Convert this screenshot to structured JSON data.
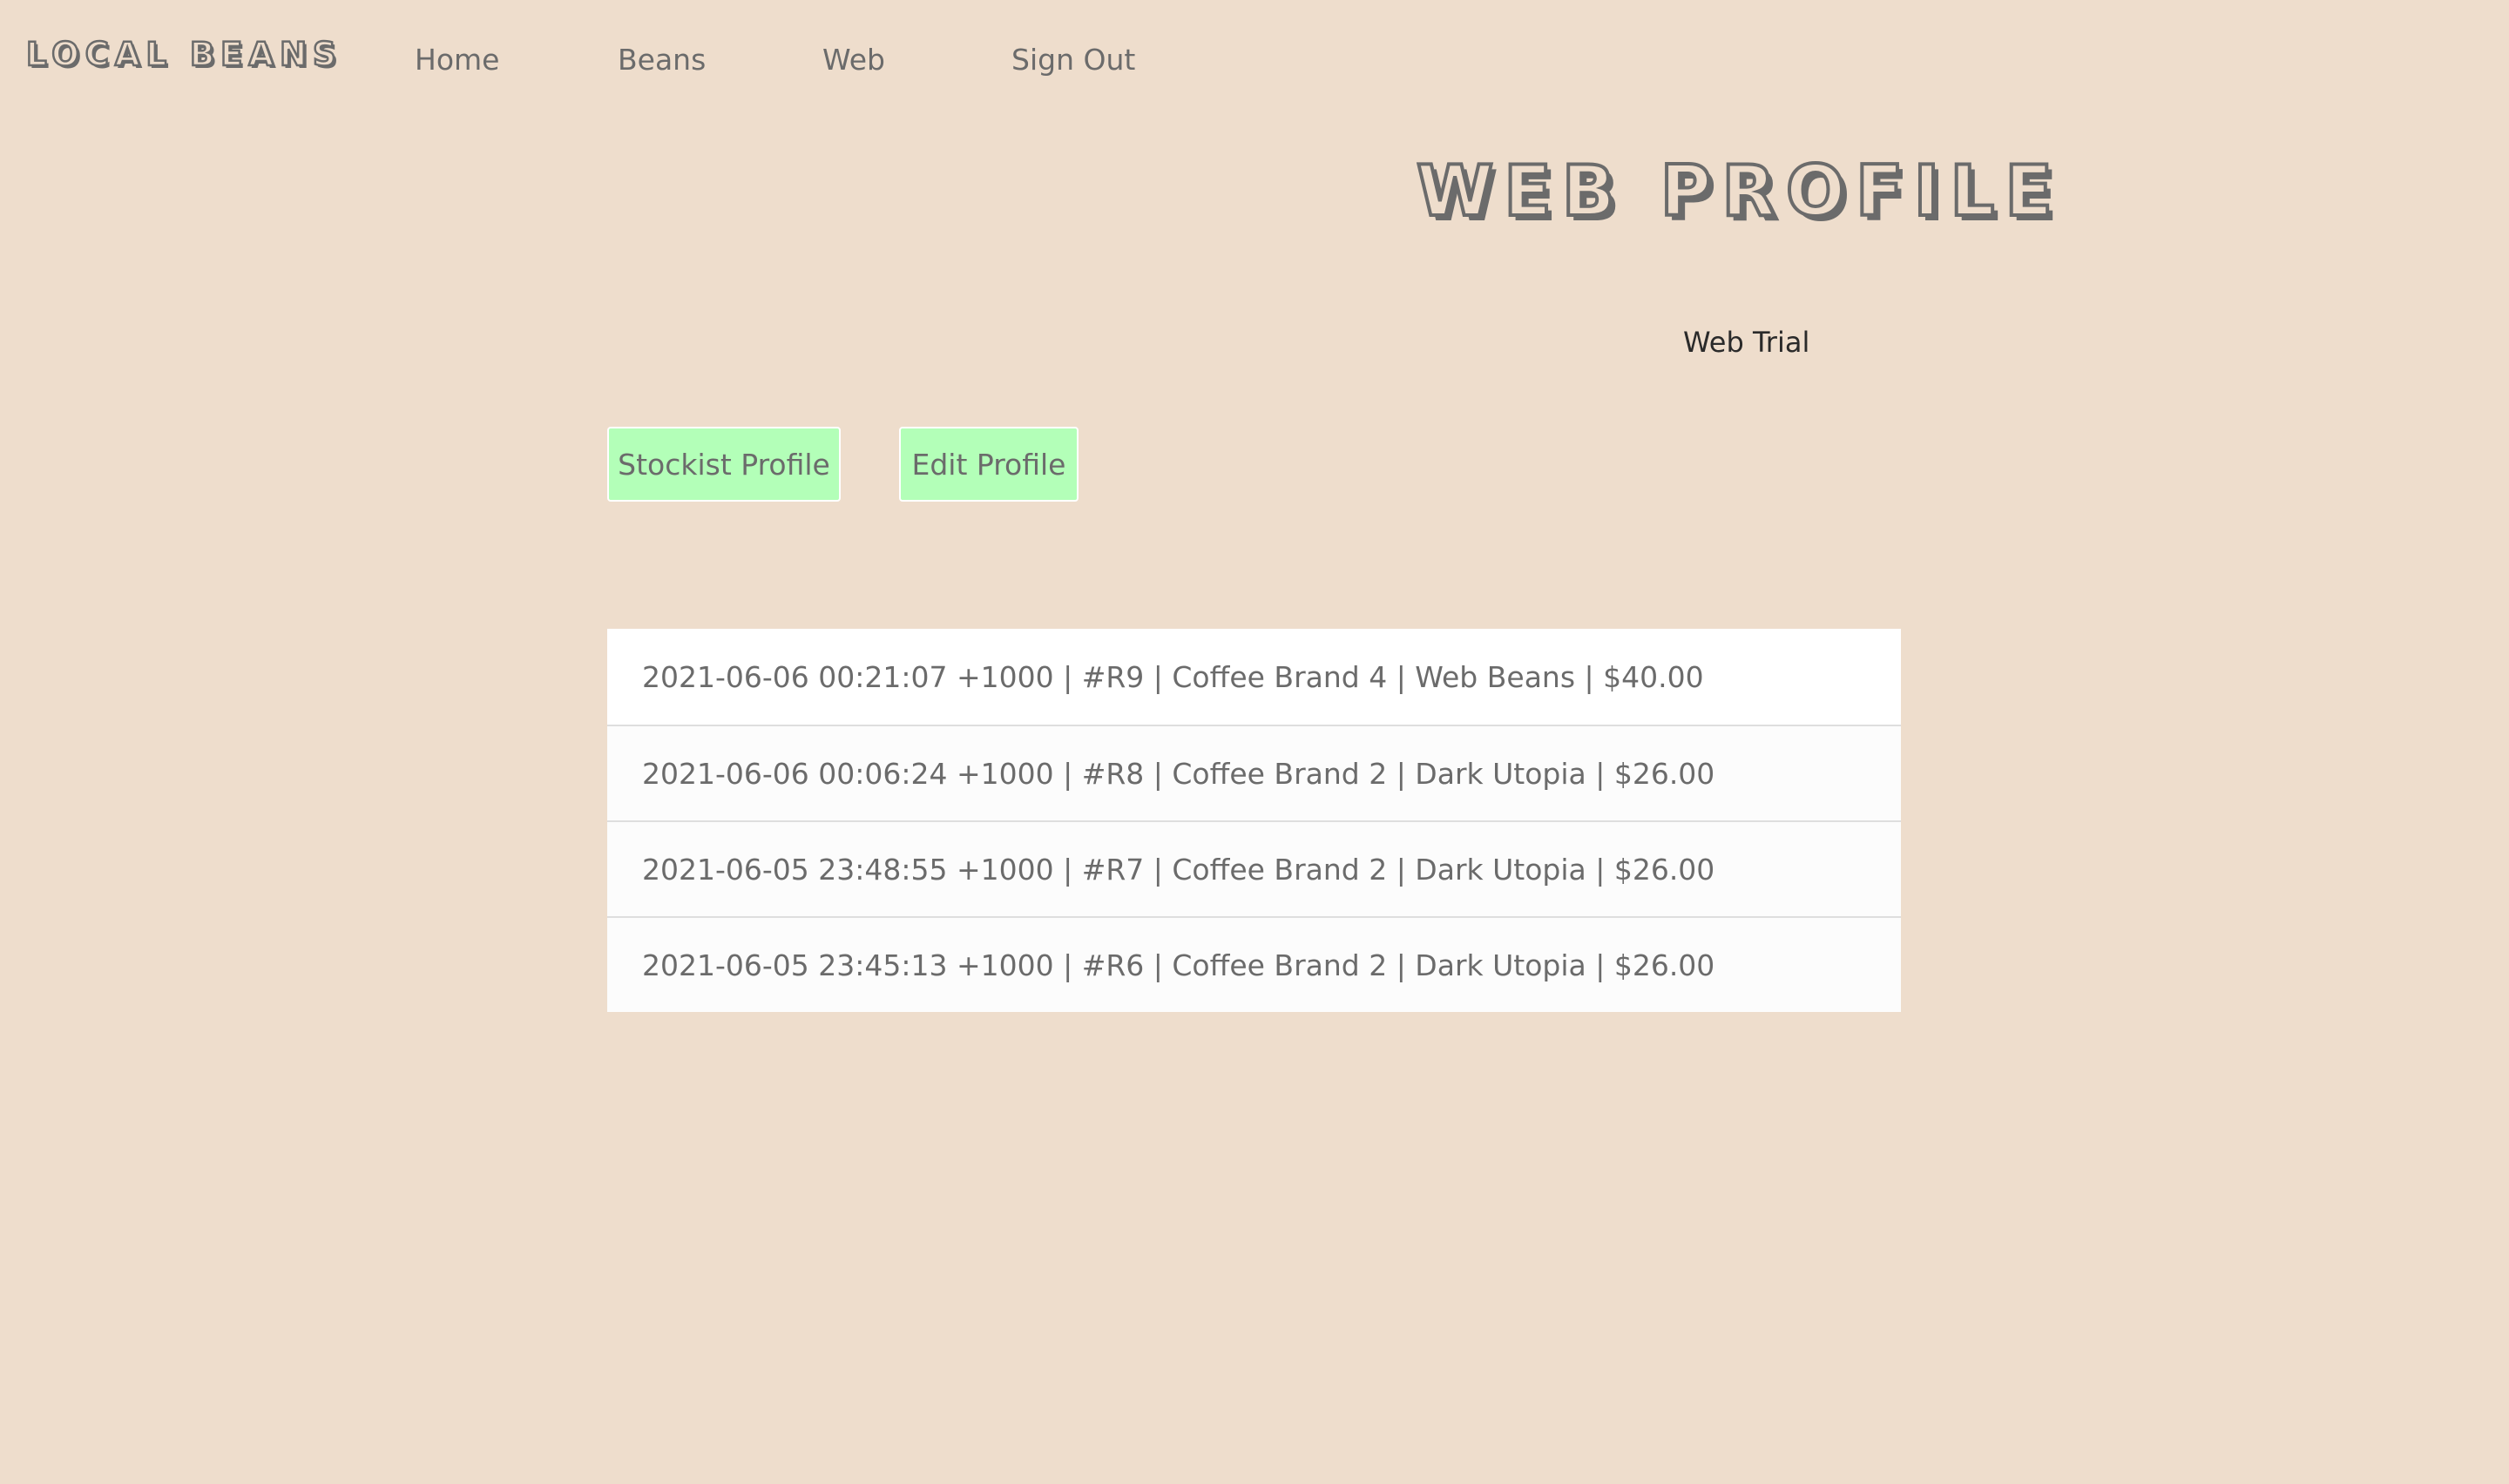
{
  "brand": {
    "logo_text": "LOCAL BEANS"
  },
  "nav": {
    "items": [
      {
        "label": "Home"
      },
      {
        "label": "Beans"
      },
      {
        "label": "Web"
      },
      {
        "label": "Sign Out"
      }
    ]
  },
  "main": {
    "title": "WEB PROFILE",
    "subtitle": "Web Trial",
    "buttons": {
      "stockist_profile": "Stockist Profile",
      "edit_profile": "Edit Profile"
    },
    "orders": [
      {
        "text": "2021-06-06 00:21:07 +1000 | #R9 | Coffee Brand 4 | Web Beans | $40.00"
      },
      {
        "text": "2021-06-06 00:06:24 +1000 | #R8 | Coffee Brand 2 | Dark Utopia | $26.00"
      },
      {
        "text": "2021-06-05 23:48:55 +1000 | #R7 | Coffee Brand 2 | Dark Utopia | $26.00"
      },
      {
        "text": "2021-06-05 23:45:13 +1000 | #R6 | Coffee Brand 2 | Dark Utopia | $26.00"
      }
    ]
  },
  "colors": {
    "background": "#eeddcc",
    "button_bg": "#b3ffb8",
    "text": "#6b6b6b",
    "list_bg": "#fcfcfc"
  }
}
